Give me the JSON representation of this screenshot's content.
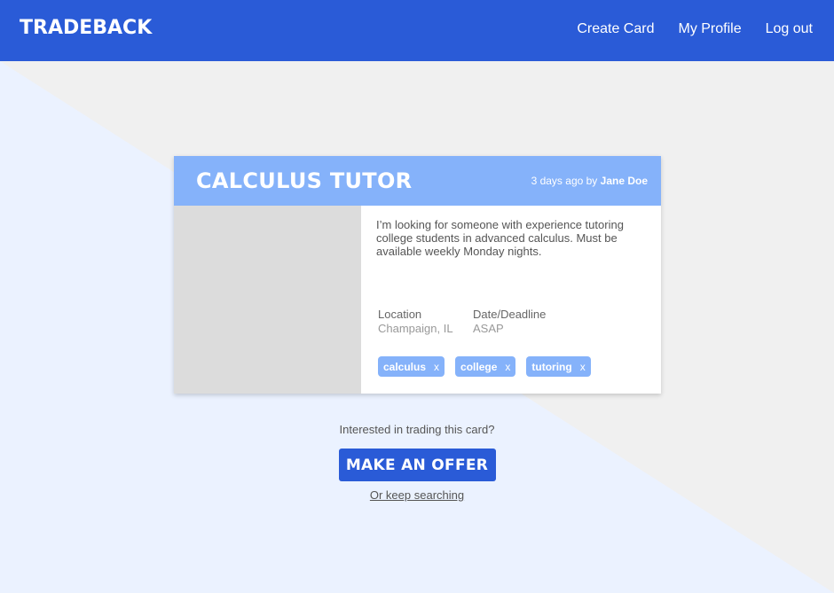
{
  "app": {
    "logo": "TRADEBACK"
  },
  "nav": {
    "items": [
      {
        "label": "Create Card"
      },
      {
        "label": "My Profile"
      },
      {
        "label": "Log out"
      }
    ]
  },
  "card": {
    "title": "CALCULUS TUTOR",
    "posted": "3 days ago by",
    "author": "Jane Doe",
    "description": "I’m looking for someone with experience tutoring college students in advanced calculus. Must be available weekly Monday nights.",
    "location_label": "Location",
    "location_value": "Champaign, IL",
    "deadline_label": "Date/Deadline",
    "deadline_value": "ASAP",
    "tags": [
      {
        "label": "calculus",
        "remove": "x"
      },
      {
        "label": "college",
        "remove": "x"
      },
      {
        "label": "tutoring",
        "remove": "x"
      }
    ]
  },
  "cta": {
    "question": "Interested in trading this card?",
    "button": "MAKE AN OFFER",
    "link": "Or keep searching"
  },
  "colors": {
    "primary": "#2a5bd7",
    "card_header": "#85b2fa",
    "background_light": "#ebf2ff",
    "background_gray": "#f0f0f0"
  }
}
